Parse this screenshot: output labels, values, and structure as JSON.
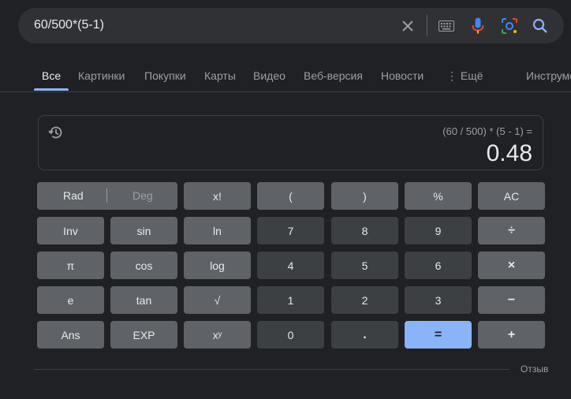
{
  "search": {
    "query": "60/500*(5-1)"
  },
  "tabs": [
    {
      "label": "Все"
    },
    {
      "label": "Картинки"
    },
    {
      "label": "Покупки"
    },
    {
      "label": "Карты"
    },
    {
      "label": "Видео"
    },
    {
      "label": "Веб-версия"
    },
    {
      "label": "Новости"
    },
    {
      "label": "⋮ Ещё"
    },
    {
      "label": "Инструменты"
    }
  ],
  "calculator": {
    "expression": "(60 / 500) * (5 - 1) =",
    "result": "0.48",
    "mode": {
      "rad": "Rad",
      "deg": "Deg"
    },
    "keys": {
      "fact": "x!",
      "lparen": "(",
      "rparen": ")",
      "percent": "%",
      "ac": "AC",
      "inv": "Inv",
      "sin": "sin",
      "ln": "ln",
      "seven": "7",
      "eight": "8",
      "nine": "9",
      "divide": "÷",
      "pi": "π",
      "cos": "cos",
      "log": "log",
      "four": "4",
      "five": "5",
      "six": "6",
      "multiply": "×",
      "e": "e",
      "tan": "tan",
      "sqrt": "√",
      "one": "1",
      "two": "2",
      "three": "3",
      "minus": "−",
      "ans": "Ans",
      "exp": "EXP",
      "pow": "xʸ",
      "zero": "0",
      "dot": ".",
      "equals": "=",
      "plus": "+"
    }
  },
  "footer": {
    "feedback": "Отзыв"
  },
  "colors": {
    "background": "#202124",
    "function_key": "#5f6368",
    "number_key": "#3c4043",
    "equals_key": "#8ab4f8"
  }
}
